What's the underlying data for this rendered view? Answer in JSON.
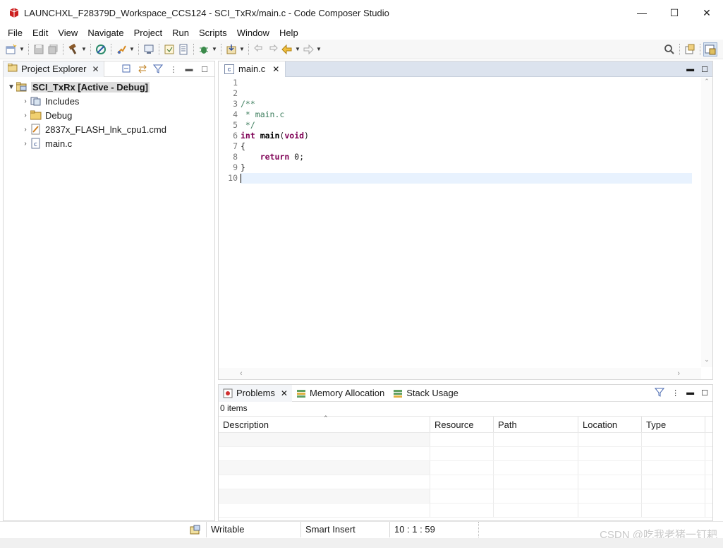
{
  "window": {
    "title": "LAUNCHXL_F28379D_Workspace_CCS124 - SCI_TxRx/main.c - Code Composer Studio",
    "minimize": "—",
    "maximize": "☐",
    "close": "✕"
  },
  "menu": [
    "File",
    "Edit",
    "View",
    "Navigate",
    "Project",
    "Run",
    "Scripts",
    "Window",
    "Help"
  ],
  "project_explorer": {
    "tab_label": "Project Explorer",
    "tree": {
      "root": "SCI_TxRx  [Active - Debug]",
      "children": [
        "Includes",
        "Debug",
        "2837x_FLASH_lnk_cpu1.cmd",
        "main.c"
      ]
    }
  },
  "editor": {
    "tab_label": "main.c",
    "line_numbers": [
      "1",
      "2",
      "3",
      "4",
      "5",
      "6",
      "7",
      "8",
      "9",
      "10"
    ],
    "code_lines": [
      "",
      "",
      "/**",
      " * main.c",
      " */",
      "int main(void)",
      "{",
      "    return 0;",
      "}",
      ""
    ]
  },
  "problems": {
    "tabs": [
      "Problems",
      "Memory Allocation",
      "Stack Usage"
    ],
    "count": "0 items",
    "columns": [
      "Description",
      "Resource",
      "Path",
      "Location",
      "Type"
    ]
  },
  "status": {
    "writable": "Writable",
    "insert_mode": "Smart Insert",
    "position": "10 : 1 : 59"
  },
  "watermark": "CSDN @吃我老猪一钉耙",
  "colors": {
    "accent": "#dce3ee",
    "keyword": "#7f0055",
    "comment": "#3f7f5f",
    "current_line": "#e8f2fe"
  }
}
